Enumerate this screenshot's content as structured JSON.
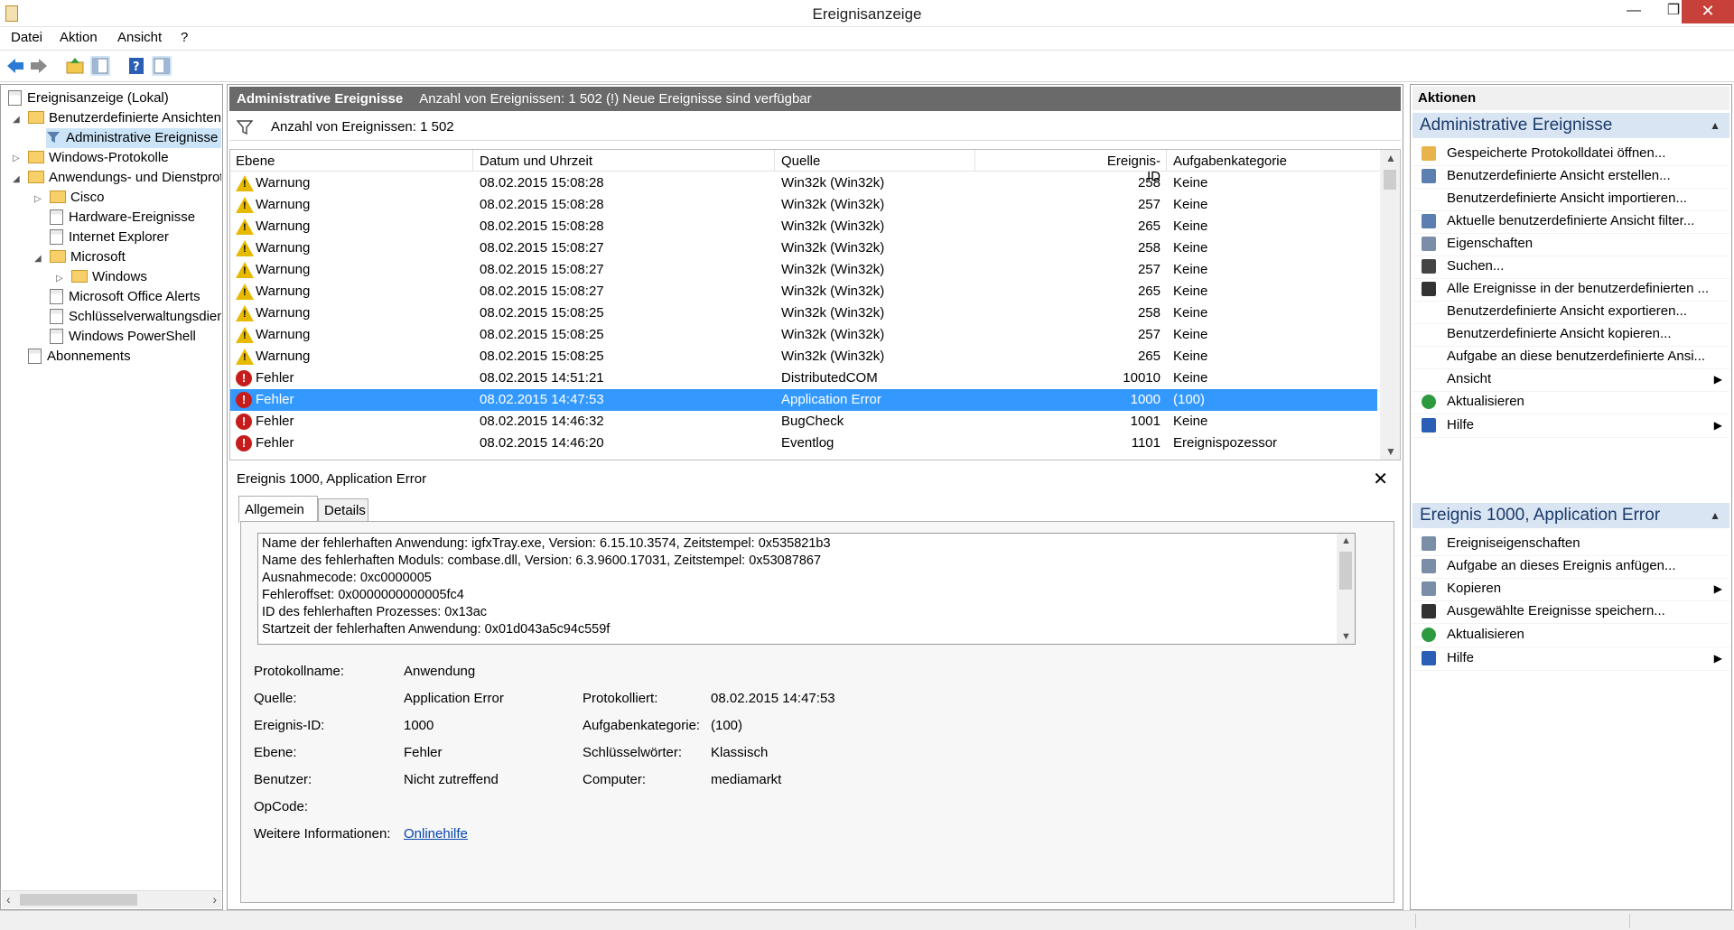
{
  "window": {
    "title": "Ereignisanzeige",
    "min": "—",
    "max": "❐",
    "close": "✕"
  },
  "menu": [
    "Datei",
    "Aktion",
    "Ansicht",
    "?"
  ],
  "tree": {
    "root": "Ereignisanzeige (Lokal)",
    "custom_views": "Benutzerdefinierte Ansichten",
    "admin_events": "Administrative Ereignisse",
    "windows_logs": "Windows-Protokolle",
    "app_services": "Anwendungs- und Dienstprotokolle",
    "cisco": "Cisco",
    "hardware": "Hardware-Ereignisse",
    "ie": "Internet Explorer",
    "microsoft": "Microsoft",
    "windows": "Windows",
    "office_alerts": "Microsoft Office Alerts",
    "key_mgmt": "Schlüsselverwaltungsdienst",
    "powershell": "Windows PowerShell",
    "subscriptions": "Abonnements"
  },
  "center": {
    "header_title": "Administrative Ereignisse",
    "header_info": "Anzahl von Ereignissen: 1 502 (!) Neue Ereignisse sind verfügbar",
    "filter_text": "Anzahl von Ereignissen: 1 502",
    "columns": [
      "Ebene",
      "Datum und Uhrzeit",
      "Quelle",
      "Ereignis-ID",
      "Aufgabenkategorie"
    ],
    "rows": [
      {
        "level": "Warnung",
        "date": "08.02.2015 15:08:28",
        "source": "Win32k (Win32k)",
        "id": "258",
        "category": "Keine"
      },
      {
        "level": "Warnung",
        "date": "08.02.2015 15:08:28",
        "source": "Win32k (Win32k)",
        "id": "257",
        "category": "Keine"
      },
      {
        "level": "Warnung",
        "date": "08.02.2015 15:08:28",
        "source": "Win32k (Win32k)",
        "id": "265",
        "category": "Keine"
      },
      {
        "level": "Warnung",
        "date": "08.02.2015 15:08:27",
        "source": "Win32k (Win32k)",
        "id": "258",
        "category": "Keine"
      },
      {
        "level": "Warnung",
        "date": "08.02.2015 15:08:27",
        "source": "Win32k (Win32k)",
        "id": "257",
        "category": "Keine"
      },
      {
        "level": "Warnung",
        "date": "08.02.2015 15:08:27",
        "source": "Win32k (Win32k)",
        "id": "265",
        "category": "Keine"
      },
      {
        "level": "Warnung",
        "date": "08.02.2015 15:08:25",
        "source": "Win32k (Win32k)",
        "id": "258",
        "category": "Keine"
      },
      {
        "level": "Warnung",
        "date": "08.02.2015 15:08:25",
        "source": "Win32k (Win32k)",
        "id": "257",
        "category": "Keine"
      },
      {
        "level": "Warnung",
        "date": "08.02.2015 15:08:25",
        "source": "Win32k (Win32k)",
        "id": "265",
        "category": "Keine"
      },
      {
        "level": "Fehler",
        "date": "08.02.2015 14:51:21",
        "source": "DistributedCOM",
        "id": "10010",
        "category": "Keine"
      },
      {
        "level": "Fehler",
        "date": "08.02.2015 14:47:53",
        "source": "Application Error",
        "id": "1000",
        "category": "(100)"
      },
      {
        "level": "Fehler",
        "date": "08.02.2015 14:46:32",
        "source": "BugCheck",
        "id": "1001",
        "category": "Keine"
      },
      {
        "level": "Fehler",
        "date": "08.02.2015 14:46:20",
        "source": "Eventlog",
        "id": "1101",
        "category": "Ereignispozessor"
      }
    ]
  },
  "detail": {
    "title": "Ereignis 1000, Application Error",
    "close": "✕",
    "tab_general": "Allgemein",
    "tab_details": "Details",
    "description": [
      "Name der fehlerhaften Anwendung: igfxTray.exe, Version: 6.15.10.3574, Zeitstempel: 0x535821b3",
      "Name des fehlerhaften Moduls: combase.dll, Version: 6.3.9600.17031, Zeitstempel: 0x53087867",
      "Ausnahmecode: 0xc0000005",
      "Fehleroffset: 0x0000000000005fc4",
      "ID des fehlerhaften Prozesses: 0x13ac",
      "Startzeit der fehlerhaften Anwendung: 0x01d043a5c94c559f"
    ],
    "labels": {
      "log": "Protokollname:",
      "source": "Quelle:",
      "event_id": "Ereignis-ID:",
      "level": "Ebene:",
      "user": "Benutzer:",
      "opcode": "OpCode:",
      "more": "Weitere Informationen:",
      "logged": "Protokolliert:",
      "task": "Aufgabenkategorie:",
      "keywords": "Schlüsselwörter:",
      "computer": "Computer:"
    },
    "values": {
      "log": "Anwendung",
      "source": "Application Error",
      "event_id": "1000",
      "level": "Fehler",
      "user": "Nicht zutreffend",
      "opcode": "",
      "more": "Onlinehilfe",
      "logged": "08.02.2015 14:47:53",
      "task": "(100)",
      "keywords": "Klassisch",
      "computer": "mediamarkt"
    }
  },
  "actions": {
    "header": "Aktionen",
    "section1": "Administrative Ereignisse",
    "section1_items": [
      "Gespeicherte Protokolldatei öffnen...",
      "Benutzerdefinierte Ansicht erstellen...",
      "Benutzerdefinierte Ansicht importieren...",
      "Aktuelle benutzerdefinierte Ansicht filter...",
      "Eigenschaften",
      "Suchen...",
      "Alle Ereignisse in der benutzerdefinierten ...",
      "Benutzerdefinierte Ansicht exportieren...",
      "Benutzerdefinierte Ansicht kopieren...",
      "Aufgabe an diese benutzerdefinierte Ansi...",
      "Ansicht",
      "Aktualisieren",
      "Hilfe"
    ],
    "section2": "Ereignis 1000, Application Error",
    "section2_items": [
      "Ereigniseigenschaften",
      "Aufgabe an dieses Ereignis anfügen...",
      "Kopieren",
      "Ausgewählte Ereignisse speichern...",
      "Aktualisieren",
      "Hilfe"
    ]
  },
  "colors": {
    "selection": "#3399ff",
    "section_bg": "#d9e5f3",
    "header_bar": "#6a6a6a",
    "close_btn": "#c7403a"
  }
}
